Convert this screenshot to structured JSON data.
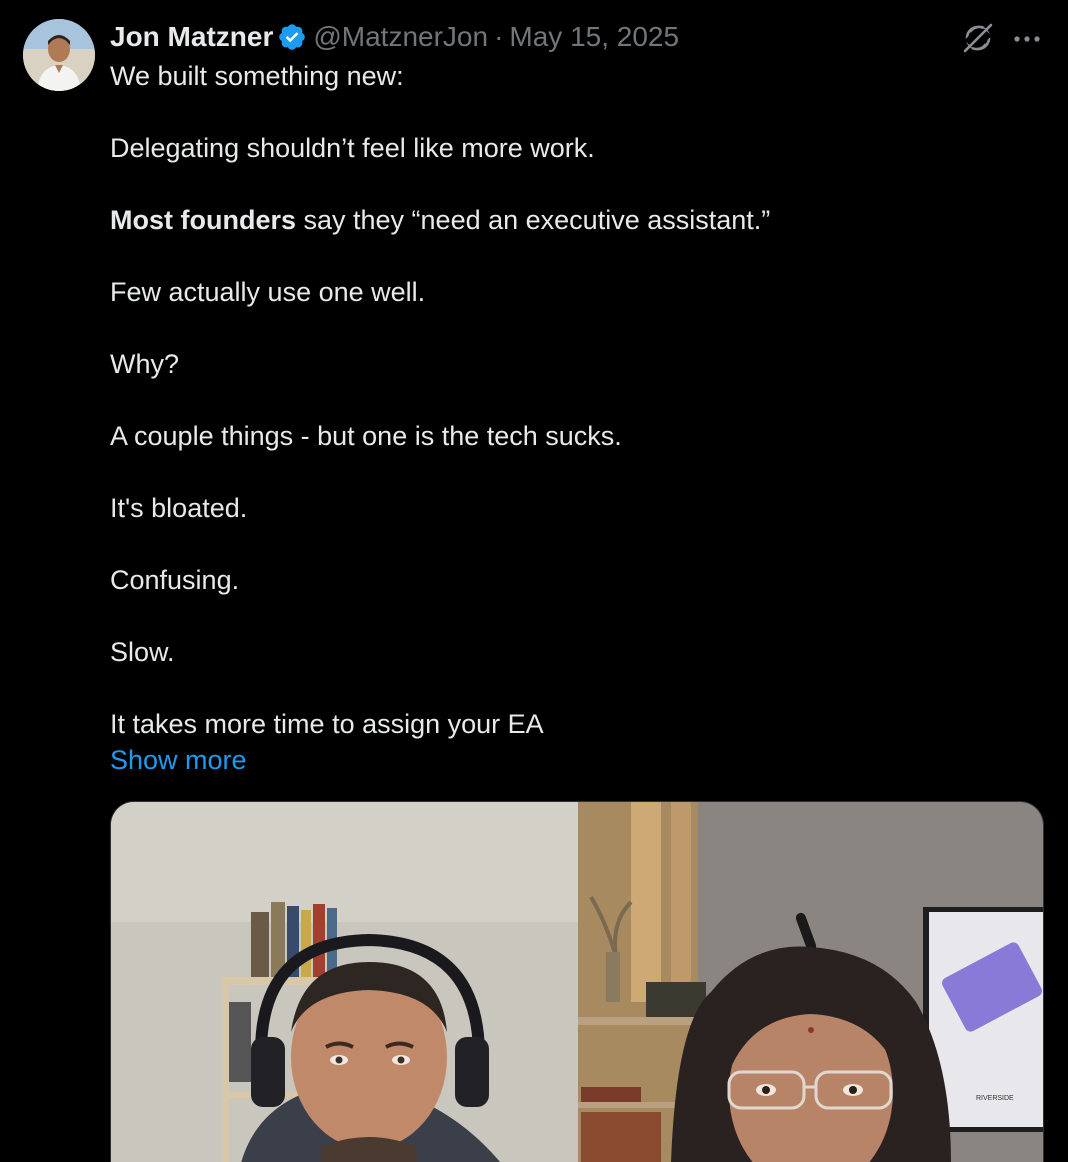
{
  "author": {
    "name": "Jon Matzner",
    "handle": "@MatznerJon",
    "separator": "·",
    "date": "May 15, 2025",
    "verified": true
  },
  "icons": {
    "avatar": "avatar-photo",
    "verified": "verified-badge-icon",
    "grok": "grok-icon",
    "more": "more-options-icon"
  },
  "colors": {
    "background": "#000000",
    "text": "#e7e9ea",
    "secondary": "#71767b",
    "link": "#1d9bf0",
    "verified": "#1d9bf0"
  },
  "tweet": {
    "line1": "We built something new:",
    "line2": "Delegating shouldn’t feel like more work.",
    "line3_bold": "Most founders",
    "line3_rest": " say they “need an executive assistant.”",
    "line4": "Few actually use one well.",
    "line5": "Why?",
    "line6": "A couple things - but one is the tech sucks.",
    "line7": "It's bloated.",
    "line8": "Confusing.",
    "line9": "Slow.",
    "line10": "It takes more time to assign your EA",
    "show_more": "Show more"
  },
  "media": {
    "type": "video-thumbnail",
    "poster_text": "RIVERSIDE"
  }
}
